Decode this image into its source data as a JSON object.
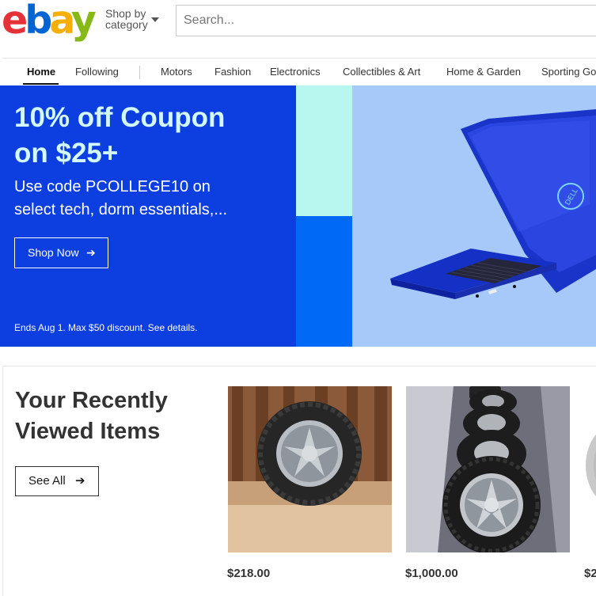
{
  "header": {
    "logo": {
      "e": "e",
      "b": "b",
      "a": "a",
      "y": "y"
    },
    "shop_by_line1": "Shop by",
    "shop_by_line2": "category",
    "search_placeholder": "Search..."
  },
  "nav": {
    "items": [
      {
        "label": "Home"
      },
      {
        "label": "Following"
      },
      {
        "label": "Motors"
      },
      {
        "label": "Fashion"
      },
      {
        "label": "Electronics"
      },
      {
        "label": "Collectibles & Art"
      },
      {
        "label": "Home & Garden"
      },
      {
        "label": "Sporting Go"
      }
    ]
  },
  "banner": {
    "headline_line1": "10% off Coupon",
    "headline_line2": "on $25+",
    "subline_line1": "Use code PCOLLEGE10 on",
    "subline_line2": "select tech, dorm essentials,...",
    "cta_label": "Shop Now",
    "cta_arrow": "➔",
    "fine_print": "Ends Aug 1. Max $50 discount. See details.",
    "laptop_brand": "DELL",
    "colors": {
      "left": "#0d3ee0",
      "headline": "#d1f9ff",
      "cyan": "#b7f7ef",
      "blue": "#0069f5",
      "right": "#a6c9fa"
    }
  },
  "recently_viewed": {
    "title_line1": "Your Recently",
    "title_line2": "Viewed Items",
    "see_all_label": "See All",
    "see_all_arrow": "➔",
    "items": [
      {
        "price": "$218.00",
        "icon": "tire-icon"
      },
      {
        "price": "$1,000.00",
        "icon": "tire-icon"
      },
      {
        "price": "$2",
        "icon": "tire-icon"
      }
    ]
  }
}
